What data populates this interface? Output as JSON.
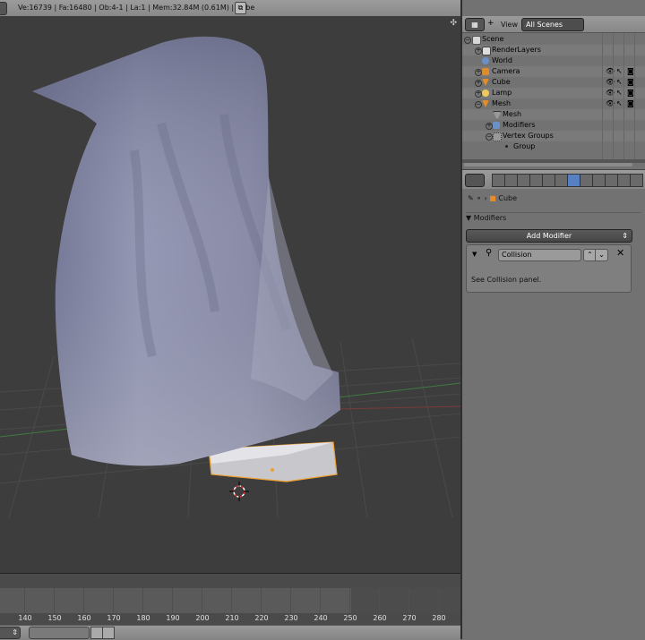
{
  "info_header": {
    "stats": "Ve:16739 | Fa:16480 | Ob:4-1 | La:1 | Mem:32.84M (0.61M) | Cube"
  },
  "outliner": {
    "view_label": "View",
    "display_mode": "All Scenes",
    "items": [
      {
        "label": "Scene",
        "icon": "scene-icon"
      },
      {
        "label": "RenderLayers",
        "icon": "renderlayers-icon"
      },
      {
        "label": "World",
        "icon": "world-icon"
      },
      {
        "label": "Camera",
        "icon": "camera-icon"
      },
      {
        "label": "Cube",
        "icon": "mesh-object-icon"
      },
      {
        "label": "Lamp",
        "icon": "lamp-icon"
      },
      {
        "label": "Mesh",
        "icon": "mesh-object-icon"
      },
      {
        "label": "Mesh",
        "icon": "mesh-data-icon"
      },
      {
        "label": "Modifiers",
        "icon": "wrench-icon"
      },
      {
        "label": "Vertex Groups",
        "icon": "vertex-groups-icon"
      },
      {
        "label": "Group",
        "icon": "dot-icon"
      }
    ]
  },
  "properties": {
    "breadcrumb_object": "Cube",
    "panel_title": "Modifiers",
    "add_modifier_label": "Add Modifier",
    "modifier": {
      "name": "Collision",
      "info": "See Collision panel."
    }
  },
  "timeline": {
    "ticks": [
      "140",
      "150",
      "160",
      "170",
      "180",
      "190",
      "200",
      "210",
      "220",
      "230",
      "240",
      "250",
      "260",
      "270",
      "280"
    ]
  },
  "colors": {
    "viewport_bg": "#3d3d3d",
    "panel_bg": "#727272",
    "active_tab": "#5680c2",
    "selection_orange": "#f0a030",
    "mesh_surface": "#8a8ea8"
  }
}
